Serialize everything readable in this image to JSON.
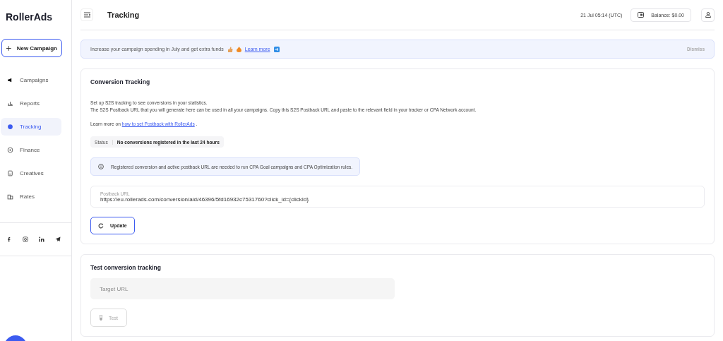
{
  "logo": "RollerAds",
  "sidebar": {
    "new_campaign": "New Campaign",
    "items": [
      {
        "label": "Campaigns",
        "selected": false
      },
      {
        "label": "Reports",
        "selected": false
      },
      {
        "label": "Tracking",
        "selected": true
      },
      {
        "label": "Finance",
        "selected": false
      },
      {
        "label": "Creatives",
        "selected": false
      },
      {
        "label": "Rates",
        "selected": false
      }
    ]
  },
  "header": {
    "title": "Tracking",
    "time": "21 Jul 05:14 (UTC)",
    "balance": "Balance: $0.00"
  },
  "banner": {
    "text": "Increase your campaign spending in July and get extra funds",
    "link": "Learn more",
    "dismiss": "Dismiss"
  },
  "conversion": {
    "title": "Conversion Tracking",
    "line_1": "Set up S2S tracking to see conversions in your statistics.",
    "line_2": "The S2S Postback URL that you will generate here can be used in all your campaigns. Copy this S2S Postback URL and paste to the relevant field in your tracker or CPA Network account.",
    "learn_prefix": "Learn more on",
    "learn_link": "how to set Postback with RollerAds",
    "learn_suffix": ".",
    "status_label": "Status",
    "status_value": "No conversions registered in the last 24 hours",
    "info": "Registered conversion and active postback URL are needed to run CPA Goal campaigns and CPA Optimization rules.",
    "postback_label": "Postback URL",
    "postback_value": "https://eu.rollerads.com/conversion/aid/46396/5fd16932c7531760?click_id={clickId}",
    "update": "Update"
  },
  "test": {
    "title": "Test conversion tracking",
    "placeholder": "Target URL",
    "button": "Test",
    "disabled": true
  }
}
